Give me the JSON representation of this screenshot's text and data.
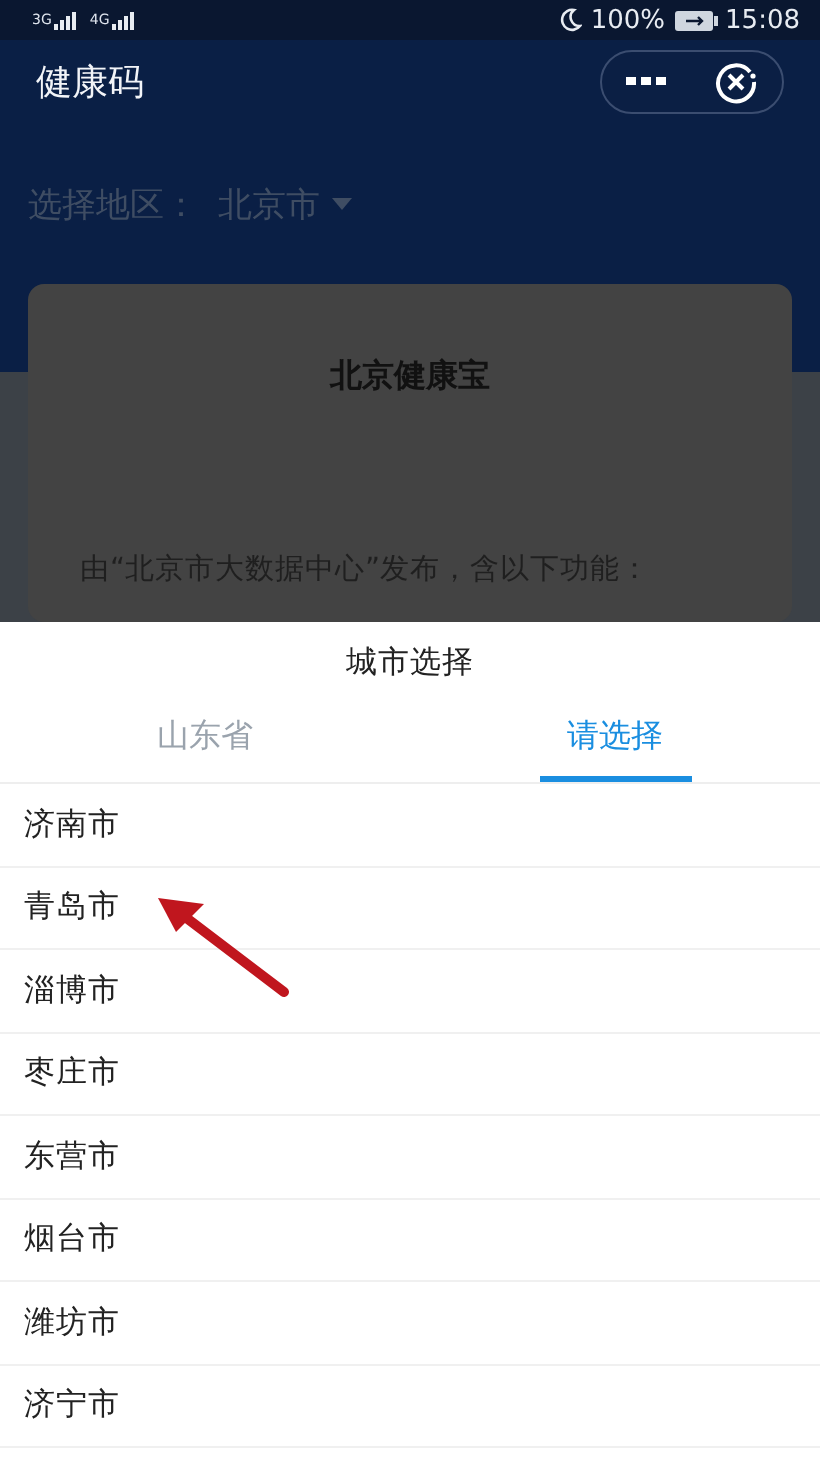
{
  "status_bar": {
    "networks": [
      "3G",
      "4G"
    ],
    "battery": "100%",
    "time": "15:08"
  },
  "header": {
    "title": "健康码"
  },
  "region": {
    "label": "选择地区：",
    "value": "北京市"
  },
  "card": {
    "title": "北京健康宝",
    "text": "由“北京市大数据中心”发布，含以下功能："
  },
  "sheet": {
    "title": "城市选择",
    "tabs": [
      {
        "label": "山东省",
        "selected": false
      },
      {
        "label": "请选择",
        "selected": true
      }
    ],
    "cities": [
      "济南市",
      "青岛市",
      "淄博市",
      "枣庄市",
      "东营市",
      "烟台市",
      "潍坊市",
      "济宁市"
    ]
  }
}
